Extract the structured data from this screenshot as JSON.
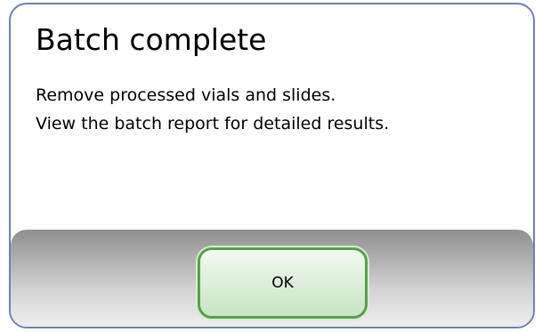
{
  "dialog": {
    "title": "Batch complete",
    "message_lines": [
      "Remove processed vials and slides.",
      "View the batch report for detailed results."
    ],
    "ok_label": "OK"
  },
  "colors": {
    "border": "#6f81b2",
    "button_border": "#5a9d4f",
    "button_fill": "#dff0dc"
  }
}
